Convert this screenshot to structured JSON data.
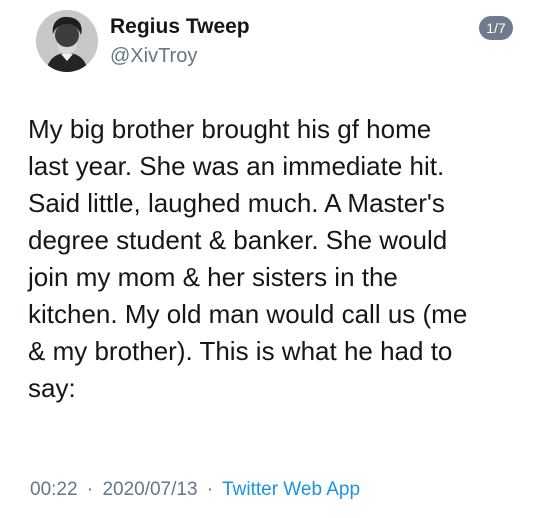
{
  "tweet": {
    "author": {
      "name": "Regius Tweep",
      "handle": "@XivTroy"
    },
    "thread_counter": "1/7",
    "body_lines": [
      "My big brother brought his gf home",
      "last year. She was an immediate hit.",
      "Said little, laughed much. A Master's",
      "degree student & banker. She would",
      "join my mom & her sisters in the",
      "kitchen. My old man would call us (me",
      "& my brother). This is what he had to",
      "say:"
    ],
    "meta": {
      "time": "00:22",
      "separator": "·",
      "date": "2020/07/13",
      "source": "Twitter Web App"
    }
  },
  "colors": {
    "text": "#14171a",
    "muted": "#657786",
    "link": "#1b95e0",
    "badge": "#6e7b8a"
  },
  "icons": {
    "avatar": "portrait-avatar"
  }
}
